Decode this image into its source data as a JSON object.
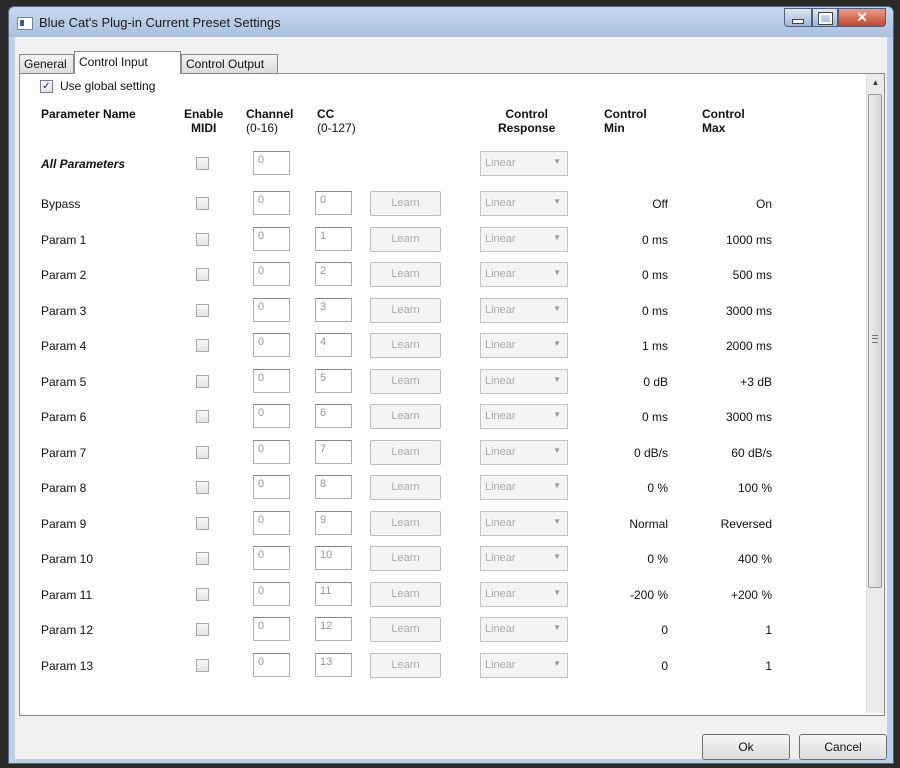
{
  "window": {
    "title": "Blue Cat's Plug-in Current Preset Settings",
    "close_glyph": "✕"
  },
  "tabs": [
    {
      "label": "General",
      "active": false
    },
    {
      "label": "Control Input",
      "active": true
    },
    {
      "label": "Control Output",
      "active": false
    }
  ],
  "global_setting": {
    "label": "Use global setting",
    "checked": true
  },
  "headers": {
    "param_name": "Parameter Name",
    "enable": "Enable",
    "enable_sub": "MIDI",
    "channel": "Channel",
    "channel_sub": "(0-16)",
    "cc": "CC",
    "cc_sub": "(0-127)",
    "response": "Control",
    "response_sub": "Response",
    "min": "Control",
    "min_sub": "Min",
    "max": "Control",
    "max_sub": "Max"
  },
  "all_params": {
    "label": "All Parameters",
    "channel": "0",
    "response": "Linear"
  },
  "rows": [
    {
      "name": "Bypass",
      "channel": "0",
      "cc": "0",
      "learn": "Learn",
      "response": "Linear",
      "min": "Off",
      "max": "On"
    },
    {
      "name": "Param 1",
      "channel": "0",
      "cc": "1",
      "learn": "Learn",
      "response": "Linear",
      "min": "0 ms",
      "max": "1000 ms"
    },
    {
      "name": "Param 2",
      "channel": "0",
      "cc": "2",
      "learn": "Learn",
      "response": "Linear",
      "min": "0 ms",
      "max": "500 ms"
    },
    {
      "name": "Param 3",
      "channel": "0",
      "cc": "3",
      "learn": "Learn",
      "response": "Linear",
      "min": "0 ms",
      "max": "3000 ms"
    },
    {
      "name": "Param 4",
      "channel": "0",
      "cc": "4",
      "learn": "Learn",
      "response": "Linear",
      "min": "1 ms",
      "max": "2000 ms"
    },
    {
      "name": "Param 5",
      "channel": "0",
      "cc": "5",
      "learn": "Learn",
      "response": "Linear",
      "min": "0 dB",
      "max": "+3 dB"
    },
    {
      "name": "Param 6",
      "channel": "0",
      "cc": "6",
      "learn": "Learn",
      "response": "Linear",
      "min": "0 ms",
      "max": "3000 ms"
    },
    {
      "name": "Param 7",
      "channel": "0",
      "cc": "7",
      "learn": "Learn",
      "response": "Linear",
      "min": "0 dB/s",
      "max": "60 dB/s"
    },
    {
      "name": "Param 8",
      "channel": "0",
      "cc": "8",
      "learn": "Learn",
      "response": "Linear",
      "min": "0 %",
      "max": "100 %"
    },
    {
      "name": "Param 9",
      "channel": "0",
      "cc": "9",
      "learn": "Learn",
      "response": "Linear",
      "min": "Normal",
      "max": "Reversed"
    },
    {
      "name": "Param 10",
      "channel": "0",
      "cc": "10",
      "learn": "Learn",
      "response": "Linear",
      "min": "0 %",
      "max": "400 %"
    },
    {
      "name": "Param 11",
      "channel": "0",
      "cc": "11",
      "learn": "Learn",
      "response": "Linear",
      "min": "-200 %",
      "max": "+200 %"
    },
    {
      "name": "Param 12",
      "channel": "0",
      "cc": "12",
      "learn": "Learn",
      "response": "Linear",
      "min": "0",
      "max": "1"
    },
    {
      "name": "Param 13",
      "channel": "0",
      "cc": "13",
      "learn": "Learn",
      "response": "Linear",
      "min": "0",
      "max": "1"
    }
  ],
  "buttons": {
    "ok": "Ok",
    "cancel": "Cancel"
  },
  "icons": {
    "checkmark": "✓",
    "combo_arrow": "▼",
    "scroll_up": "▲"
  }
}
